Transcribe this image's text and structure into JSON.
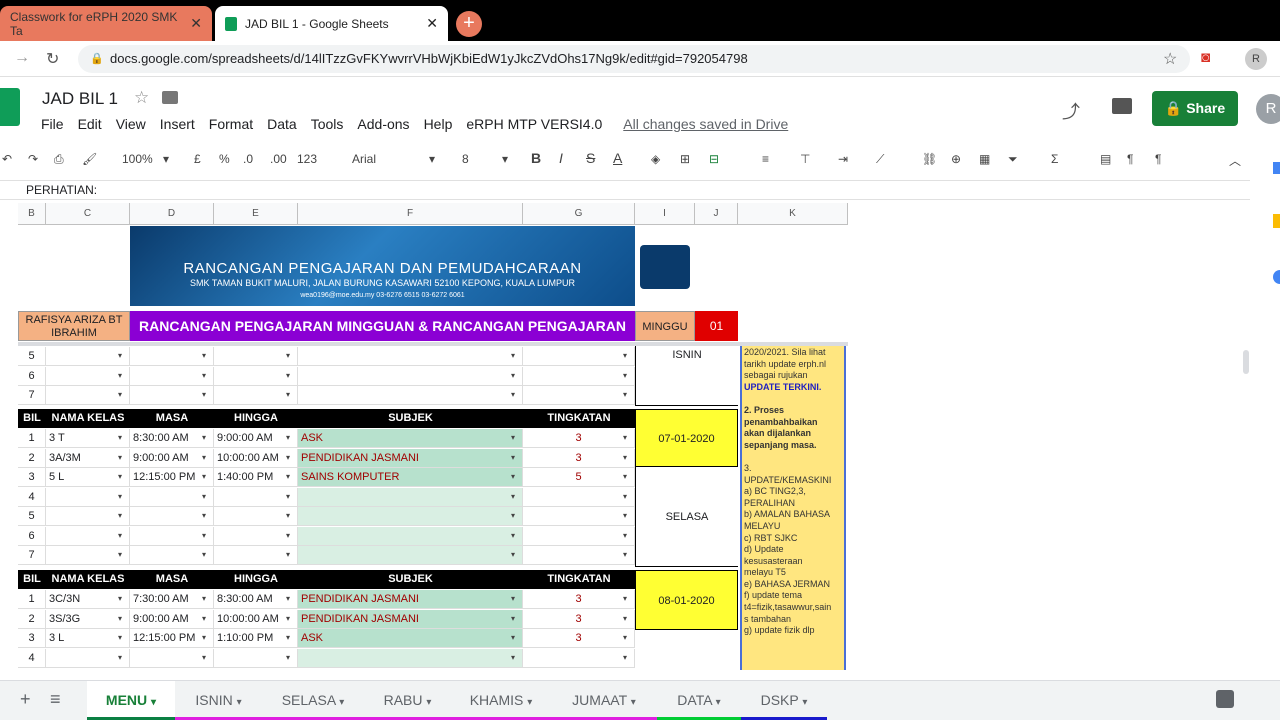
{
  "browser": {
    "tabs": [
      {
        "title": "Classwork for eRPH 2020 SMK Ta"
      },
      {
        "title": "JAD BIL 1 - Google Sheets"
      }
    ],
    "url": "docs.google.com/spreadsheets/d/14lITzzGvFKYwvrrVHbWjKbiEdW1yJkcZVdOhs17Ng9k/edit#gid=792054798",
    "avatar": "R"
  },
  "doc": {
    "title": "JAD BIL 1",
    "saved": "All changes saved in Drive",
    "share": "Share",
    "menus": [
      "File",
      "Edit",
      "View",
      "Insert",
      "Format",
      "Data",
      "Tools",
      "Add-ons",
      "Help",
      "eRPH MTP VERSI4.0"
    ]
  },
  "toolbar": {
    "zoom": "100%",
    "currency": "£",
    "percent": "%",
    "dec1": ".0",
    "dec2": ".00",
    "fmt": "123",
    "font": "Arial",
    "size": "8"
  },
  "formula": "PERHATIAN:",
  "columns": [
    "B",
    "C",
    "D",
    "E",
    "F",
    "G",
    "I",
    "J",
    "K"
  ],
  "banner": {
    "line1": "RANCANGAN PENGAJARAN DAN PEMUDAHCARAAN",
    "line2": "SMK TAMAN BUKIT MALURI, JALAN BURUNG KASAWARI 52100 KEPONG, KUALA LUMPUR",
    "line3": "wea0196@moe.edu.my   03-6276 6515   03-6272 6061"
  },
  "teacher": "RAFISYA ARIZA BT IBRAHIM",
  "plan_title": "RANCANGAN PENGAJARAN MINGGUAN & RANCANGAN PENGAJARAN HARIAN",
  "minggu_label": "MINGGU",
  "minggu": "01",
  "headers": {
    "bil": "BIL",
    "kelas": "NAMA KELAS",
    "masa": "MASA",
    "hingga": "HINGGA",
    "subjek": "SUBJEK",
    "tingkatan": "TINGKATAN"
  },
  "top_rows": [
    "5",
    "6",
    "7"
  ],
  "day_isnin": "ISNIN",
  "block1": {
    "date": "07-01-2020",
    "day": "SELASA",
    "rows": [
      {
        "bil": "1",
        "kelas": "3 T",
        "masa": "8:30:00 AM",
        "hingga": "9:00:00 AM",
        "subjek": "ASK",
        "ting": "3"
      },
      {
        "bil": "2",
        "kelas": "3A/3M",
        "masa": "9:00:00 AM",
        "hingga": "10:00:00 AM",
        "subjek": "PENDIDIKAN JASMANI",
        "ting": "3"
      },
      {
        "bil": "3",
        "kelas": "5 L",
        "masa": "12:15:00 PM",
        "hingga": "1:40:00 PM",
        "subjek": "SAINS KOMPUTER",
        "ting": "5"
      },
      {
        "bil": "4",
        "kelas": "",
        "masa": "",
        "hingga": "",
        "subjek": "",
        "ting": ""
      },
      {
        "bil": "5",
        "kelas": "",
        "masa": "",
        "hingga": "",
        "subjek": "",
        "ting": ""
      },
      {
        "bil": "6",
        "kelas": "",
        "masa": "",
        "hingga": "",
        "subjek": "",
        "ting": ""
      },
      {
        "bil": "7",
        "kelas": "",
        "masa": "",
        "hingga": "",
        "subjek": "",
        "ting": ""
      }
    ]
  },
  "block2": {
    "date": "08-01-2020",
    "rows": [
      {
        "bil": "1",
        "kelas": "3C/3N",
        "masa": "7:30:00 AM",
        "hingga": "8:30:00 AM",
        "subjek": "PENDIDIKAN JASMANI",
        "ting": "3"
      },
      {
        "bil": "2",
        "kelas": "3S/3G",
        "masa": "9:00:00 AM",
        "hingga": "10:00:00 AM",
        "subjek": "PENDIDIKAN JASMANI",
        "ting": "3"
      },
      {
        "bil": "3",
        "kelas": "3 L",
        "masa": "12:15:00 PM",
        "hingga": "1:10:00 PM",
        "subjek": "ASK",
        "ting": "3"
      },
      {
        "bil": "4",
        "kelas": "",
        "masa": "",
        "hingga": "",
        "subjek": "",
        "ting": ""
      }
    ]
  },
  "notes": [
    "2020/2021. Sila lihat",
    "tarikh update erph.nl",
    "sebagai rujukan",
    "UPDATE TERKINI.",
    "",
    "2. Proses",
    "penambahbaikan",
    "akan dijalankan",
    "sepanjang masa.",
    "",
    "3.",
    "UPDATE/KEMASKINI",
    "a) BC TING2,3,",
    "PERALIHAN",
    "b) AMALAN BAHASA",
    "MELAYU",
    "c) RBT SJKC",
    "d) Update",
    "kesusasteraan",
    "melayu T5",
    "e) BAHASA JERMAN",
    "f) update tema",
    "t4=fizik,tasawwur,sain",
    "s tambahan",
    "g) update fizik dlp"
  ],
  "sheet_tabs": [
    {
      "name": "MENU",
      "color": "#0b8043"
    },
    {
      "name": "ISNIN",
      "color": "#e020e0"
    },
    {
      "name": "SELASA",
      "color": "#e020e0"
    },
    {
      "name": "RABU",
      "color": "#e020e0"
    },
    {
      "name": "KHAMIS",
      "color": "#e020e0"
    },
    {
      "name": "JUMAAT",
      "color": "#e020e0"
    },
    {
      "name": "DATA",
      "color": "#00cc33"
    },
    {
      "name": "DSKP",
      "color": "#1a1acc"
    }
  ]
}
